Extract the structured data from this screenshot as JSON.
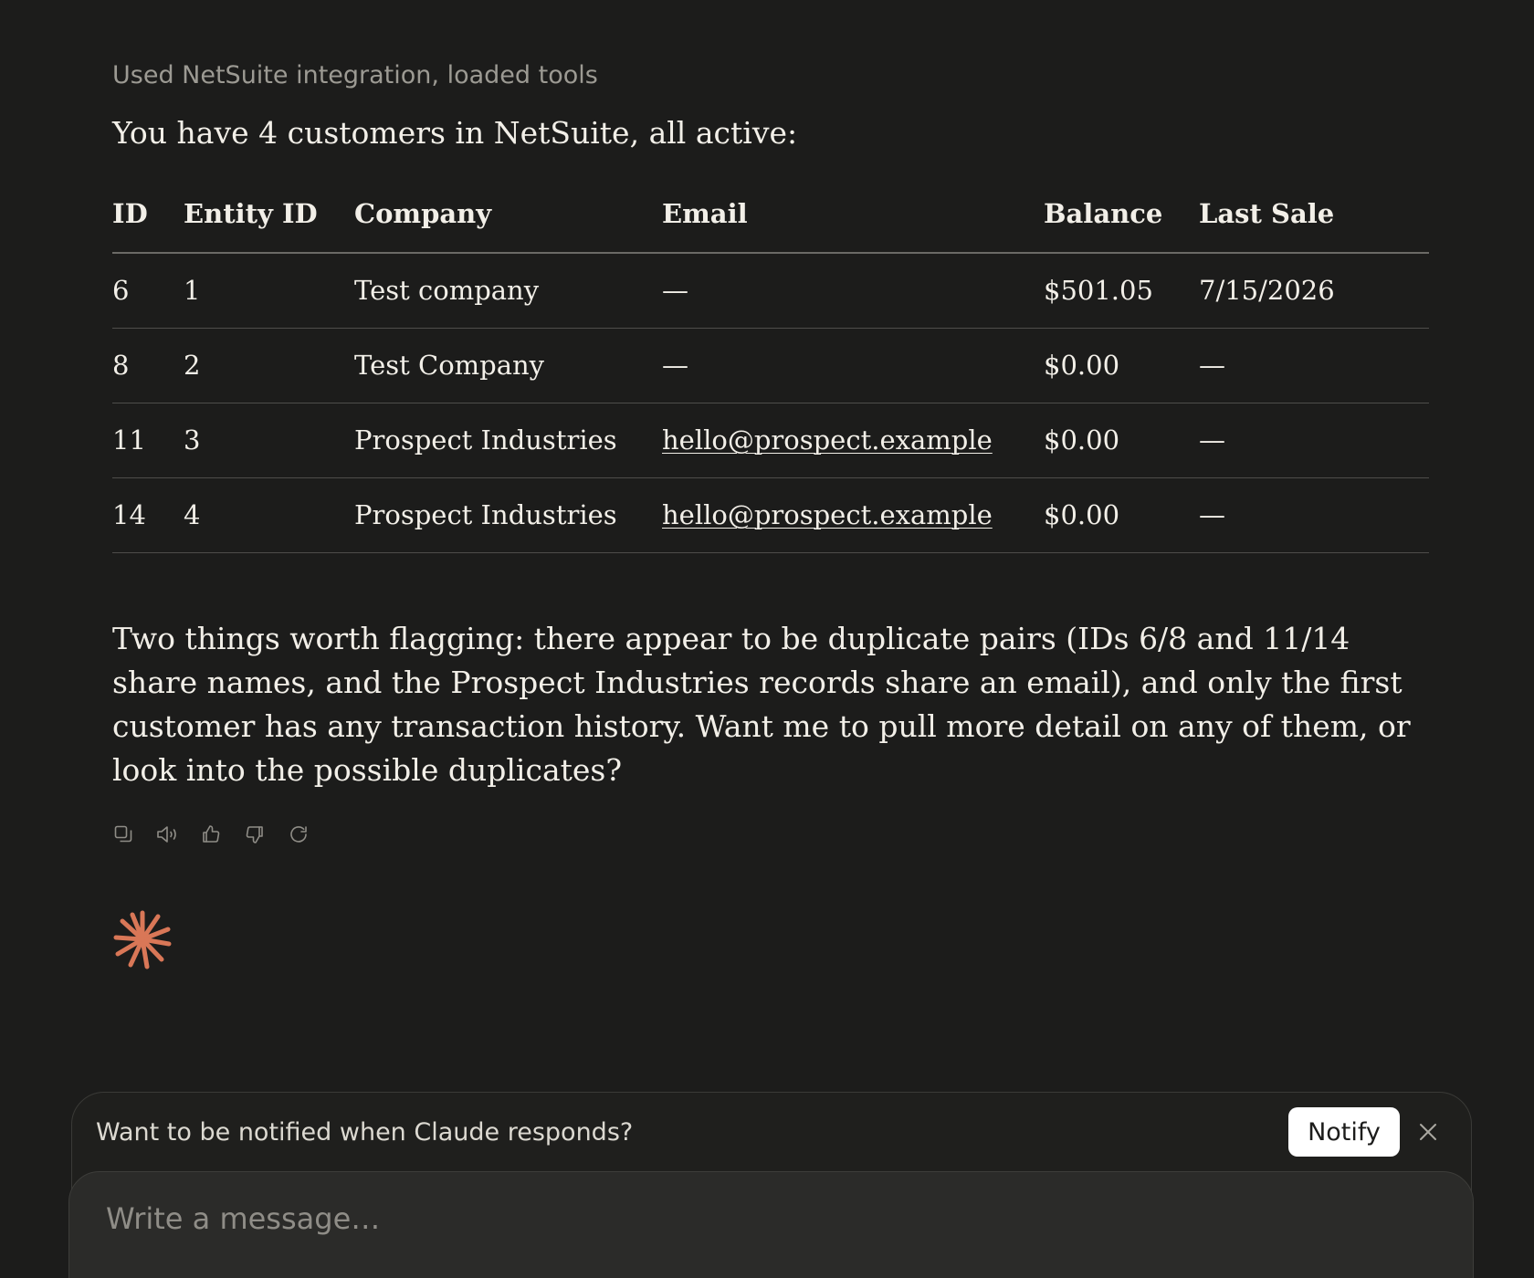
{
  "message": {
    "tool_status": "Used NetSuite integration, loaded tools",
    "intro": "You have 4 customers in NetSuite, all active:",
    "table": {
      "headers": [
        "ID",
        "Entity ID",
        "Company",
        "Email",
        "Balance",
        "Last Sale"
      ],
      "rows": [
        [
          "6",
          "1",
          "Test company",
          "—",
          "$501.05",
          "7/15/2026"
        ],
        [
          "8",
          "2",
          "Test Company",
          "—",
          "$0.00",
          "—"
        ],
        [
          "11",
          "3",
          "Prospect Industries",
          "hello@prospect.example",
          "$0.00",
          "—"
        ],
        [
          "14",
          "4",
          "Prospect Industries",
          "hello@prospect.example",
          "$0.00",
          "—"
        ]
      ]
    },
    "summary": "Two things worth flagging: there appear to be duplicate pairs (IDs 6/8 and 11/14 share names, and the Prospect Industries records share an email), and only the first customer has any transaction history. Want me to pull more detail on any of them, or look into the possible duplicates?"
  },
  "actions": {
    "icons": [
      "copy-icon",
      "speaker-icon",
      "thumbs-up-icon",
      "thumbs-down-icon",
      "retry-icon"
    ]
  },
  "notification": {
    "text": "Want to be notified when Claude responds?",
    "button_label": "Notify"
  },
  "composer": {
    "placeholder": "Write a message…"
  },
  "colors": {
    "background": "#1c1c1b",
    "text": "#f2efe8",
    "muted": "#9c9a93",
    "accent": "#d97757"
  }
}
